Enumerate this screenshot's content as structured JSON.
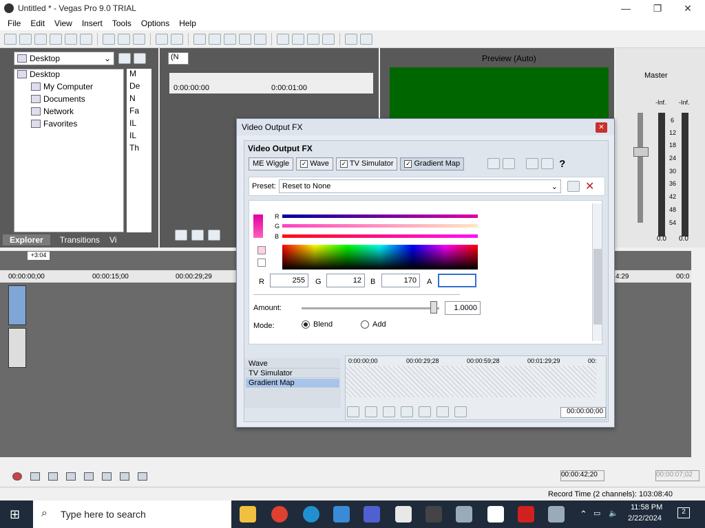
{
  "window": {
    "title": "Untitled * - Vegas Pro 9.0 TRIAL"
  },
  "menu": [
    "File",
    "Edit",
    "View",
    "Insert",
    "Tools",
    "Options",
    "Help"
  ],
  "explorer": {
    "location": "Desktop",
    "tree": [
      "Desktop",
      "My Computer",
      "Documents",
      "Network",
      "Favorites"
    ],
    "file_list": [
      "M",
      "De",
      "N",
      "Fa",
      "IL",
      "IL",
      "Th"
    ],
    "tabs": [
      "Explorer",
      "Transitions",
      "Vi"
    ]
  },
  "trimmer": {
    "zoom": "(N",
    "t0": "0:00:00:00",
    "t1": "0:00:01:00"
  },
  "preview": {
    "label": "Preview (Auto)"
  },
  "master": {
    "label": "Master",
    "ticks": [
      "-Inf.",
      "-Inf.",
      "6",
      "12",
      "18",
      "24",
      "30",
      "36",
      "42",
      "48",
      "54"
    ],
    "readouts": [
      "0.0",
      "0.0"
    ]
  },
  "timeline": {
    "cursor_offset": "+3:04",
    "ruler": [
      "00:00:00;00",
      "00:00:15;00",
      "00:00:29;29"
    ],
    "ruler_right": [
      "4:29",
      "00:0"
    ]
  },
  "dialog": {
    "title": "Video Output FX",
    "header": "Video Output FX",
    "chain": [
      "ME Wiggle",
      "Wave",
      "TV Simulator",
      "Gradient Map"
    ],
    "preset_label": "Preset:",
    "preset_value": "Reset to None",
    "channels": [
      "R",
      "G",
      "B"
    ],
    "fields": {
      "R_label": "R",
      "R": "255",
      "G_label": "G",
      "G": "12",
      "B_label": "B",
      "B": "170",
      "A_label": "A",
      "A": ""
    },
    "amount_label": "Amount:",
    "amount": "1.0000",
    "amount_fraction": 0.96,
    "mode_label": "Mode:",
    "mode_options": [
      "Blend",
      "Add"
    ],
    "mode_selected": "Blend",
    "keyframe_tracks": [
      "Wave",
      "TV Simulator",
      "Gradient Map"
    ],
    "kf_ruler": [
      "0:00:00;00",
      "00:00:29;28",
      "00:00:59;28",
      "00:01:29;29",
      "00:"
    ],
    "kf_time": "00:00:00;00"
  },
  "transport": {
    "time_left": "00:00:42;20",
    "time_right": "00:00:07;02"
  },
  "status": {
    "record_time": "Record Time (2 channels): 103:08:40"
  },
  "taskbar": {
    "search_placeholder": "Type here to search",
    "time": "11:58 PM",
    "date": "2/22/2024",
    "notif": "2"
  },
  "colors": {
    "preview_green": "#006600",
    "accent_magenta": "#e000a0",
    "dialog_bg": "#e8ecf2"
  }
}
